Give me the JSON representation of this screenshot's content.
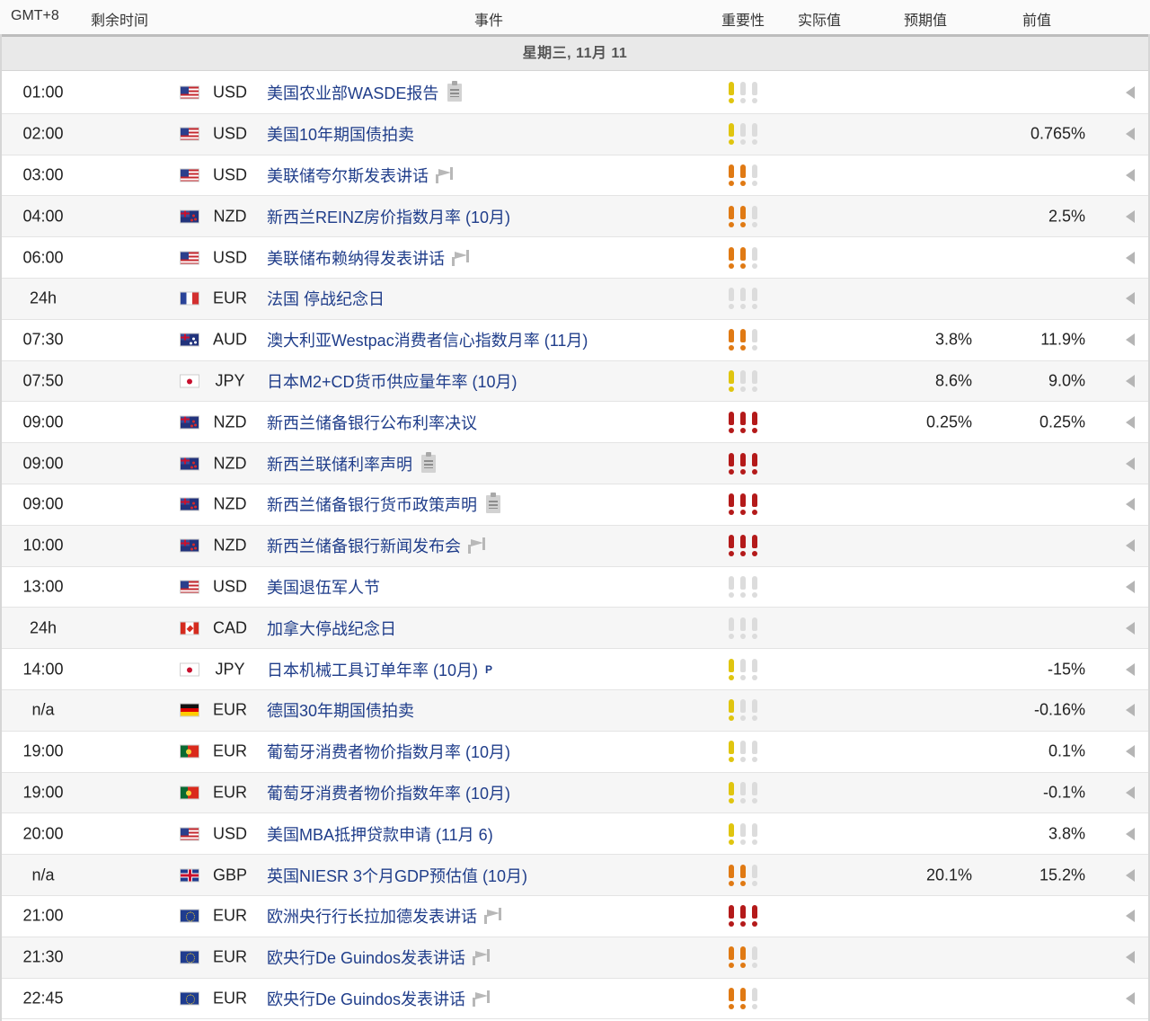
{
  "header": {
    "timezone": "GMT+8",
    "remaining": "剩余时间",
    "event": "事件",
    "importance": "重要性",
    "actual": "实际值",
    "forecast": "预期值",
    "previous": "前值"
  },
  "day_label": "星期三, 11月 11",
  "importance_colors": {
    "low": "#e0c50f",
    "medium": "#e07a14",
    "high": "#b41a1a",
    "off": "#dcdcdc"
  },
  "events": [
    {
      "time": "01:00",
      "flag": "us-flag",
      "currency": "USD",
      "title": "美国农业部WASDE报告",
      "icon": "document-icon",
      "importance": 1,
      "actual": "",
      "forecast": "",
      "previous": ""
    },
    {
      "time": "02:00",
      "flag": "us-flag",
      "currency": "USD",
      "title": "美国10年期国债拍卖",
      "icon": "",
      "importance": 1,
      "actual": "",
      "forecast": "",
      "previous": "0.765%"
    },
    {
      "time": "03:00",
      "flag": "us-flag",
      "currency": "USD",
      "title": "美联储夸尔斯发表讲话",
      "icon": "speech-icon",
      "importance": 2,
      "actual": "",
      "forecast": "",
      "previous": ""
    },
    {
      "time": "04:00",
      "flag": "nz-flag",
      "currency": "NZD",
      "title": "新西兰REINZ房价指数月率 (10月)",
      "icon": "",
      "importance": 2,
      "actual": "",
      "forecast": "",
      "previous": "2.5%"
    },
    {
      "time": "06:00",
      "flag": "us-flag",
      "currency": "USD",
      "title": "美联储布赖纳得发表讲话",
      "icon": "speech-icon",
      "importance": 2,
      "actual": "",
      "forecast": "",
      "previous": ""
    },
    {
      "time": "24h",
      "flag": "fr-flag",
      "currency": "EUR",
      "title": "法国 停战纪念日",
      "icon": "",
      "importance": 0,
      "actual": "",
      "forecast": "",
      "previous": ""
    },
    {
      "time": "07:30",
      "flag": "au-flag",
      "currency": "AUD",
      "title": "澳大利亚Westpac消费者信心指数月率 (11月)",
      "icon": "",
      "importance": 2,
      "actual": "",
      "forecast": "3.8%",
      "previous": "11.9%"
    },
    {
      "time": "07:50",
      "flag": "jp-flag",
      "currency": "JPY",
      "title": "日本M2+CD货币供应量年率 (10月)",
      "icon": "",
      "importance": 1,
      "actual": "",
      "forecast": "8.6%",
      "previous": "9.0%"
    },
    {
      "time": "09:00",
      "flag": "nz-flag",
      "currency": "NZD",
      "title": "新西兰储备银行公布利率决议",
      "icon": "",
      "importance": 3,
      "actual": "",
      "forecast": "0.25%",
      "previous": "0.25%"
    },
    {
      "time": "09:00",
      "flag": "nz-flag",
      "currency": "NZD",
      "title": "新西兰联储利率声明",
      "icon": "document-icon",
      "importance": 3,
      "actual": "",
      "forecast": "",
      "previous": ""
    },
    {
      "time": "09:00",
      "flag": "nz-flag",
      "currency": "NZD",
      "title": "新西兰储备银行货币政策声明",
      "icon": "document-icon",
      "importance": 3,
      "actual": "",
      "forecast": "",
      "previous": ""
    },
    {
      "time": "10:00",
      "flag": "nz-flag",
      "currency": "NZD",
      "title": "新西兰储备银行新闻发布会",
      "icon": "speech-icon",
      "importance": 3,
      "actual": "",
      "forecast": "",
      "previous": ""
    },
    {
      "time": "13:00",
      "flag": "us-flag",
      "currency": "USD",
      "title": "美国退伍军人节",
      "icon": "",
      "importance": 0,
      "actual": "",
      "forecast": "",
      "previous": ""
    },
    {
      "time": "24h",
      "flag": "ca-flag",
      "currency": "CAD",
      "title": "加拿大停战纪念日",
      "icon": "",
      "importance": 0,
      "actual": "",
      "forecast": "",
      "previous": ""
    },
    {
      "time": "14:00",
      "flag": "jp-flag",
      "currency": "JPY",
      "title": "日本机械工具订单年率 (10月)",
      "icon": "preliminary-icon",
      "icon_text": "P",
      "importance": 1,
      "actual": "",
      "forecast": "",
      "previous": "-15%"
    },
    {
      "time": "n/a",
      "flag": "de-flag",
      "currency": "EUR",
      "title": "德国30年期国债拍卖",
      "icon": "",
      "importance": 1,
      "actual": "",
      "forecast": "",
      "previous": "-0.16%"
    },
    {
      "time": "19:00",
      "flag": "pt-flag",
      "currency": "EUR",
      "title": "葡萄牙消费者物价指数月率 (10月)",
      "icon": "",
      "importance": 1,
      "actual": "",
      "forecast": "",
      "previous": "0.1%"
    },
    {
      "time": "19:00",
      "flag": "pt-flag",
      "currency": "EUR",
      "title": "葡萄牙消费者物价指数年率 (10月)",
      "icon": "",
      "importance": 1,
      "actual": "",
      "forecast": "",
      "previous": "-0.1%"
    },
    {
      "time": "20:00",
      "flag": "us-flag",
      "currency": "USD",
      "title": "美国MBA抵押贷款申请 (11月 6)",
      "icon": "",
      "importance": 1,
      "actual": "",
      "forecast": "",
      "previous": "3.8%"
    },
    {
      "time": "n/a",
      "flag": "gb-flag",
      "currency": "GBP",
      "title": "英国NIESR 3个月GDP预估值 (10月)",
      "icon": "",
      "importance": 2,
      "actual": "",
      "forecast": "20.1%",
      "previous": "15.2%"
    },
    {
      "time": "21:00",
      "flag": "eu-flag",
      "currency": "EUR",
      "title": "欧洲央行行长拉加德发表讲话",
      "icon": "speech-icon",
      "importance": 3,
      "actual": "",
      "forecast": "",
      "previous": ""
    },
    {
      "time": "21:30",
      "flag": "eu-flag",
      "currency": "EUR",
      "title": "欧央行De Guindos发表讲话",
      "icon": "speech-icon",
      "importance": 2,
      "actual": "",
      "forecast": "",
      "previous": ""
    },
    {
      "time": "22:45",
      "flag": "eu-flag",
      "currency": "EUR",
      "title": "欧央行De Guindos发表讲话",
      "icon": "speech-icon",
      "importance": 2,
      "actual": "",
      "forecast": "",
      "previous": ""
    }
  ]
}
